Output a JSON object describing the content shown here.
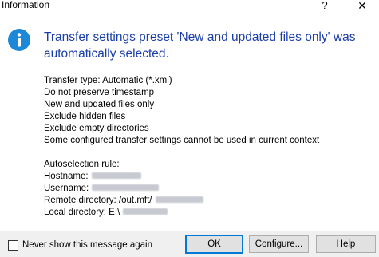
{
  "window": {
    "title": "Information",
    "help_glyph": "?",
    "close_glyph": "✕"
  },
  "message": {
    "heading": "Transfer settings preset 'New and updated files only' was automatically selected."
  },
  "details": {
    "lines": [
      "Transfer type: Automatic (*.xml)",
      "Do not preserve timestamp",
      "New and updated files only",
      "Exclude hidden files",
      "Exclude empty directories",
      "Some configured transfer settings cannot be used in current context"
    ],
    "autoselection_label": "Autoselection rule:",
    "hostname_label": "Hostname:",
    "username_label": "Username:",
    "remote_label": "Remote directory: /out.mft/",
    "local_label": "Local directory: E:\\"
  },
  "footer": {
    "checkbox_label": "Never show this message again",
    "checkbox_checked": false,
    "ok_label": "OK",
    "configure_label": "Configure...",
    "help_label": "Help"
  },
  "colors": {
    "accent": "#0078d7",
    "heading": "#1a3ea8",
    "info_icon": "#1e88d8"
  }
}
